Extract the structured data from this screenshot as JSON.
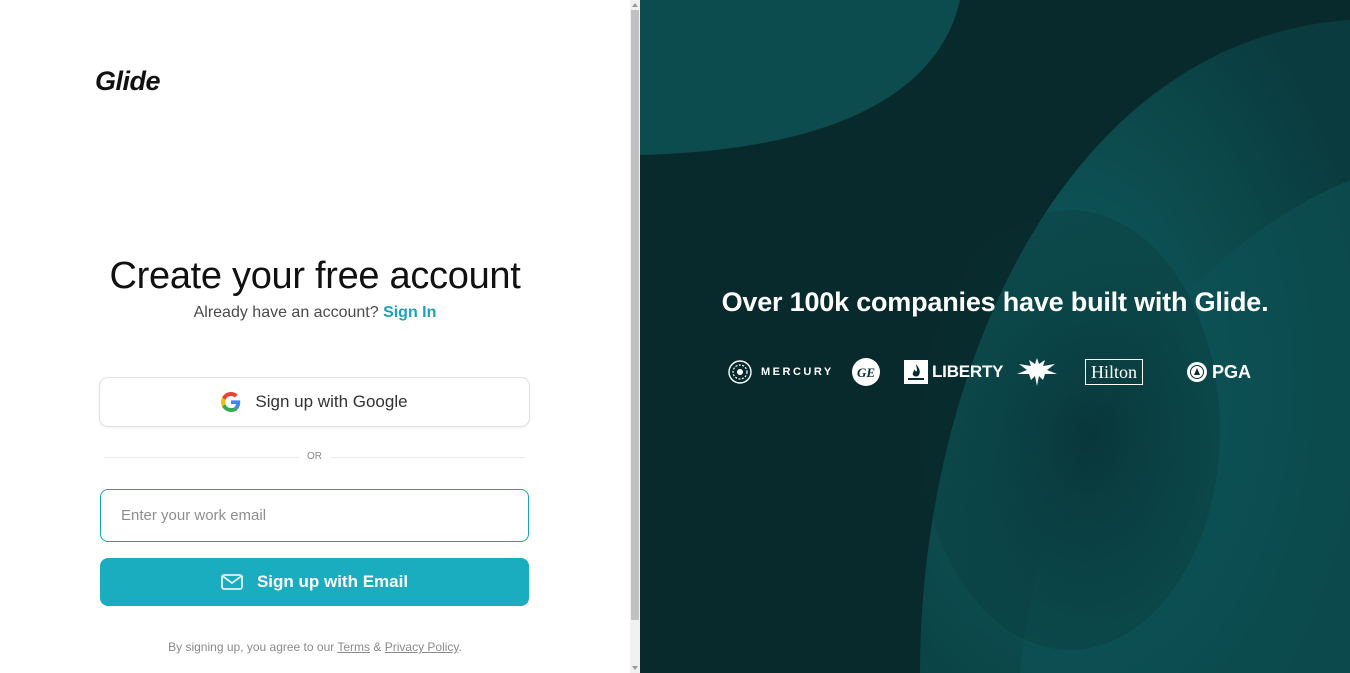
{
  "logo": {
    "text": "Glide"
  },
  "form": {
    "heading": "Create your free account",
    "have_account": "Already have an account?",
    "signin_link": "Sign In",
    "google_label": "Sign up with Google",
    "or_label": "OR",
    "email_placeholder": "Enter your work email",
    "email_value": "",
    "email_button_label": "Sign up with Email",
    "legal_prefix": "By signing up, you agree to our",
    "terms_link": "Terms",
    "ampersand": "&",
    "privacy_link": "Privacy Policy",
    "legal_suffix": "."
  },
  "promo": {
    "tagline": "Over 100k companies have built with Glide.",
    "brands": [
      {
        "name": "MERCURY",
        "icon": "mercury-seal-icon"
      },
      {
        "name": "GE",
        "icon": "ge-monogram-icon"
      },
      {
        "name": "LIBERTY",
        "icon": "liberty-flame-icon"
      },
      {
        "name": "Anheuser-Busch",
        "icon": "eagle-icon"
      },
      {
        "name": "Hilton",
        "icon": "hilton-wordmark"
      },
      {
        "name": "PGA",
        "icon": "pga-seal-icon"
      }
    ]
  },
  "colors": {
    "accent": "#1aadbf",
    "link": "#1aa3b8",
    "promo_bg": "#0a2d2f",
    "promo_glow": "#0e5a5c"
  }
}
